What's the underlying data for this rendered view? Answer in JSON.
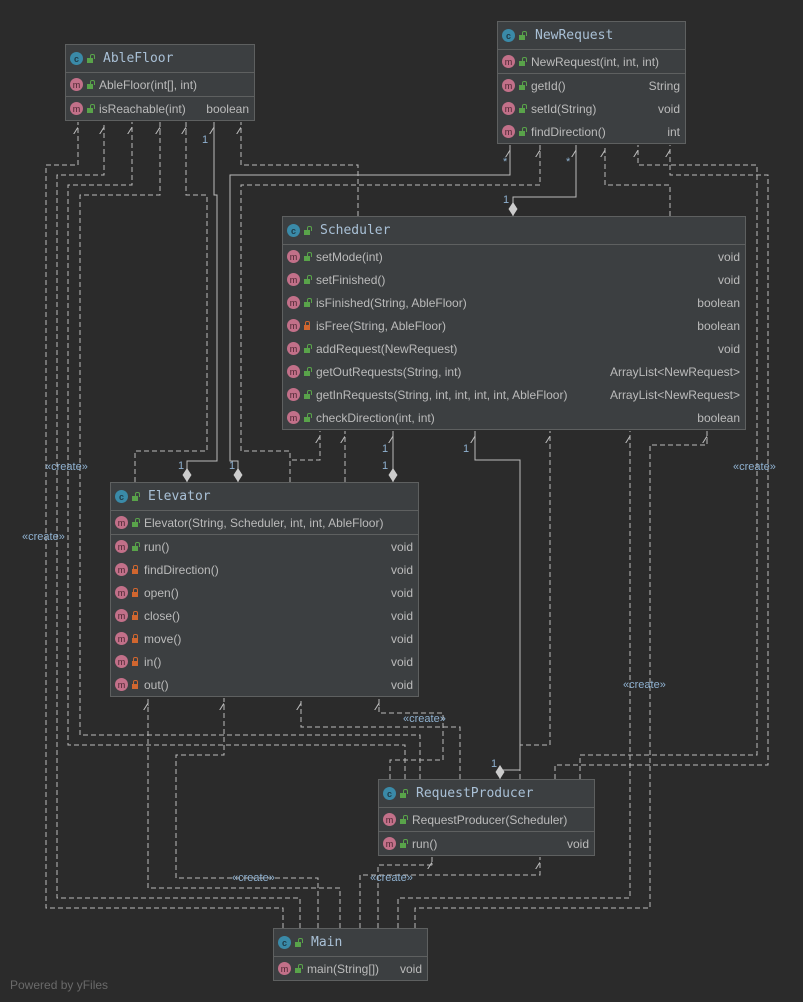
{
  "classes": [
    {
      "id": "ablefloor",
      "name": "AbleFloor",
      "sections": [
        [
          {
            "name": "AbleFloor(int[], int)",
            "type": "",
            "vis": "pub"
          }
        ],
        [
          {
            "name": "isReachable(int)",
            "type": "boolean",
            "vis": "pub"
          }
        ]
      ]
    },
    {
      "id": "newrequest",
      "name": "NewRequest",
      "sections": [
        [
          {
            "name": "NewRequest(int, int, int)",
            "type": "",
            "vis": "pub"
          }
        ],
        [
          {
            "name": "getId()",
            "type": "String",
            "vis": "pub"
          },
          {
            "name": "setId(String)",
            "type": "void",
            "vis": "pub"
          },
          {
            "name": "findDirection()",
            "type": "int",
            "vis": "pub"
          }
        ]
      ]
    },
    {
      "id": "scheduler",
      "name": "Scheduler",
      "sections": [
        [
          {
            "name": "setMode(int)",
            "type": "void",
            "vis": "pub"
          },
          {
            "name": "setFinished()",
            "type": "void",
            "vis": "pub"
          },
          {
            "name": "isFinished(String, AbleFloor)",
            "type": "boolean",
            "vis": "pub"
          },
          {
            "name": "isFree(String, AbleFloor)",
            "type": "boolean",
            "vis": "pri"
          },
          {
            "name": "addRequest(NewRequest)",
            "type": "void",
            "vis": "pub"
          },
          {
            "name": "getOutRequests(String, int)",
            "type": "ArrayList<NewRequest>",
            "vis": "pub"
          },
          {
            "name": "getInRequests(String, int, int, int, int, AbleFloor)",
            "type": "ArrayList<NewRequest>",
            "vis": "pub"
          },
          {
            "name": "checkDirection(int, int)",
            "type": "boolean",
            "vis": "pub"
          }
        ]
      ]
    },
    {
      "id": "elevator",
      "name": "Elevator",
      "sections": [
        [
          {
            "name": "Elevator(String, Scheduler, int, int, AbleFloor)",
            "type": "",
            "vis": "pub"
          }
        ],
        [
          {
            "name": "run()",
            "type": "void",
            "vis": "pub"
          },
          {
            "name": "findDirection()",
            "type": "void",
            "vis": "pri"
          },
          {
            "name": "open()",
            "type": "void",
            "vis": "pri"
          },
          {
            "name": "close()",
            "type": "void",
            "vis": "pri"
          },
          {
            "name": "move()",
            "type": "void",
            "vis": "pri"
          },
          {
            "name": "in()",
            "type": "void",
            "vis": "pri"
          },
          {
            "name": "out()",
            "type": "void",
            "vis": "pri"
          }
        ]
      ]
    },
    {
      "id": "requestproducer",
      "name": "RequestProducer",
      "sections": [
        [
          {
            "name": "RequestProducer(Scheduler)",
            "type": "",
            "vis": "pub"
          }
        ],
        [
          {
            "name": "run()",
            "type": "void",
            "vis": "pub"
          }
        ]
      ]
    },
    {
      "id": "main",
      "name": "Main",
      "sections": [
        [
          {
            "name": "main(String[])",
            "type": "void",
            "vis": "pub"
          }
        ]
      ]
    }
  ],
  "edge_labels": {
    "create": "«create»",
    "one": "1",
    "many": "*"
  },
  "footer": "Powered by yFiles",
  "colors": {
    "background": "#2b2b2b",
    "box": "#3c3f41",
    "edge": "#bbbbbb",
    "class_icon": "#3a8aa8",
    "method_icon": "#c27089"
  }
}
